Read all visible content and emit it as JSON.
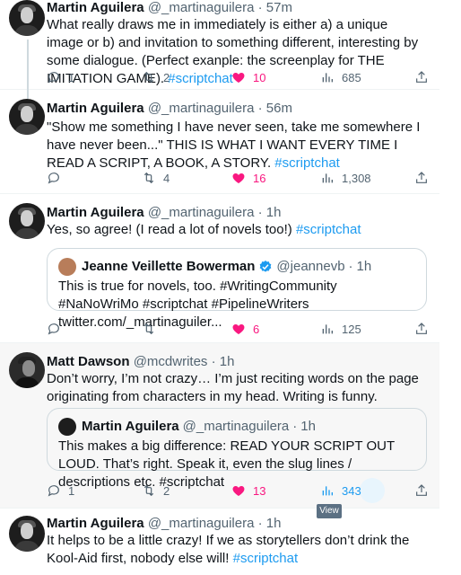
{
  "tweets": [
    {
      "name": "Martin Aguilera",
      "handle": "@_martinaguilera",
      "sep": "·",
      "time": "57m",
      "text": "What really draws me in immediately is either a) a unique image or b) and invitation to something different, interesting by some dialogue. (Perfect exanple: the screenplay for THE IMITATION GAME).",
      "hashtag": "#scriptchat",
      "replies": "1",
      "retweets": "2",
      "likes": "10",
      "views": "685"
    },
    {
      "name": "Martin Aguilera",
      "handle": "@_martinaguilera",
      "sep": "·",
      "time": "56m",
      "text": "\"Show me something I have never seen, take me somewhere I have never been...\" THIS IS WHAT I WANT EVERY TIME I READ A SCRIPT, A BOOK, A STORY.",
      "hashtag": "#scriptchat",
      "replies": "",
      "retweets": "4",
      "likes": "16",
      "views": "1,308"
    },
    {
      "name": "Martin Aguilera",
      "handle": "@_martinaguilera",
      "sep": "·",
      "time": "1h",
      "text": "Yes, so agree! (I read a lot of novels too!)",
      "hashtag": "#scriptchat",
      "quote": {
        "name": "Jeanne Veillette Bowerman",
        "handle": "@jeannevb",
        "sep": "·",
        "time": "1h",
        "text": "This is true for novels, too. #WritingCommunity #NaNoWriMo #scriptchat #PipelineWriters twitter.com/_martinaguiler..."
      },
      "replies": "",
      "retweets": "",
      "likes": "6",
      "views": "125"
    },
    {
      "name": "Matt Dawson",
      "handle": "@mcdwrites",
      "sep": "·",
      "time": "1h",
      "text": "Don’t worry, I’m not crazy… I’m just reciting words on the page originating from characters in my head. Writing is funny.",
      "quote": {
        "name": "Martin Aguilera",
        "handle": "@_martinaguilera",
        "sep": "·",
        "time": "1h",
        "text": "This makes a big difference: READ YOUR SCRIPT OUT LOUD. That’s right. Speak it, even the slug lines / descriptions etc. #scriptchat"
      },
      "replies": "1",
      "retweets": "2",
      "likes": "13",
      "views": "343"
    },
    {
      "name": "Martin Aguilera",
      "handle": "@_martinaguilera",
      "sep": "·",
      "time": "1h",
      "text": "It helps to be a little crazy! If we as storytellers don’t drink the Kool-Aid first, nobody else will!",
      "hashtag": "#scriptchat"
    }
  ],
  "tooltip": "View",
  "icons": {
    "reply": "reply-icon",
    "retweet": "retweet-icon",
    "like": "heart-icon",
    "views": "views-icon",
    "share": "share-icon",
    "verified": "verified-badge-icon"
  },
  "colors": {
    "accent": "#1d9bf0",
    "like": "#f91880",
    "muted": "#536471"
  }
}
